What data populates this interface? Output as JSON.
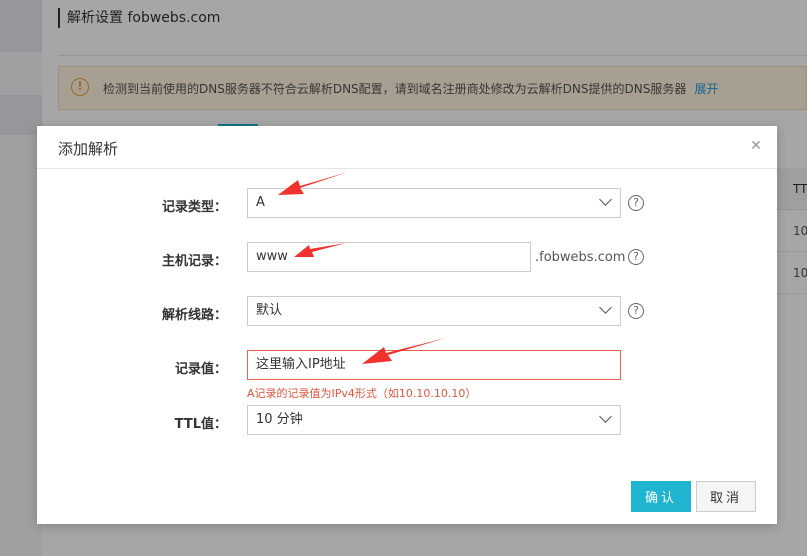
{
  "page": {
    "title": "解析设置 fobwebs.com",
    "notice": {
      "text": "检测到当前使用的DNS服务器不符合云解析DNS配置，请到域名注册商处修改为云解析DNS提供的DNS服务器",
      "expand_label": "展开",
      "icon": "warning-icon"
    },
    "table": {
      "header": "TTL",
      "rows": [
        "10",
        "10"
      ]
    }
  },
  "dialog": {
    "title": "添加解析",
    "close_icon": "close-icon",
    "fields": {
      "record_type": {
        "label": "记录类型：",
        "value": "A"
      },
      "host": {
        "label": "主机记录：",
        "value": "www",
        "suffix": ".fobwebs.com"
      },
      "line": {
        "label": "解析线路：",
        "value": "默认"
      },
      "record_value": {
        "label": "记录值：",
        "value": "这里输入IP地址",
        "error": "A记录的记录值为IPv4形式（如10.10.10.10）"
      },
      "ttl": {
        "label": "TTL值：",
        "value": "10 分钟"
      }
    },
    "help_symbol": "?",
    "ok_label": "确认",
    "cancel_label": "取消"
  },
  "colors": {
    "accent": "#1fb4cf",
    "error": "#e0553d",
    "annotation_arrow": "#f0312d",
    "notice_bg": "#fff4e0"
  }
}
